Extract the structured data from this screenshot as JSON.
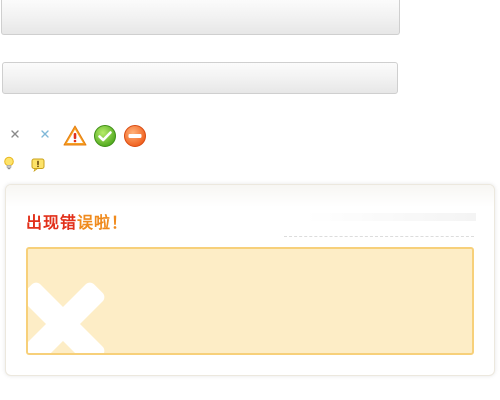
{
  "bars": {
    "top": "",
    "second": ""
  },
  "icons": {
    "row1": [
      "close-small",
      "close-small-blue",
      "warning",
      "success",
      "forbidden"
    ],
    "row2": [
      "lightbulb",
      "exclamation-bubble"
    ]
  },
  "dialog": {
    "title_part1": "出现错",
    "title_part2": "误啦！",
    "message": "",
    "colors": {
      "title_red": "#e2301a",
      "title_orange": "#f08a1c",
      "box_fill": "#fdedc6",
      "box_border": "#f7d07a"
    }
  }
}
